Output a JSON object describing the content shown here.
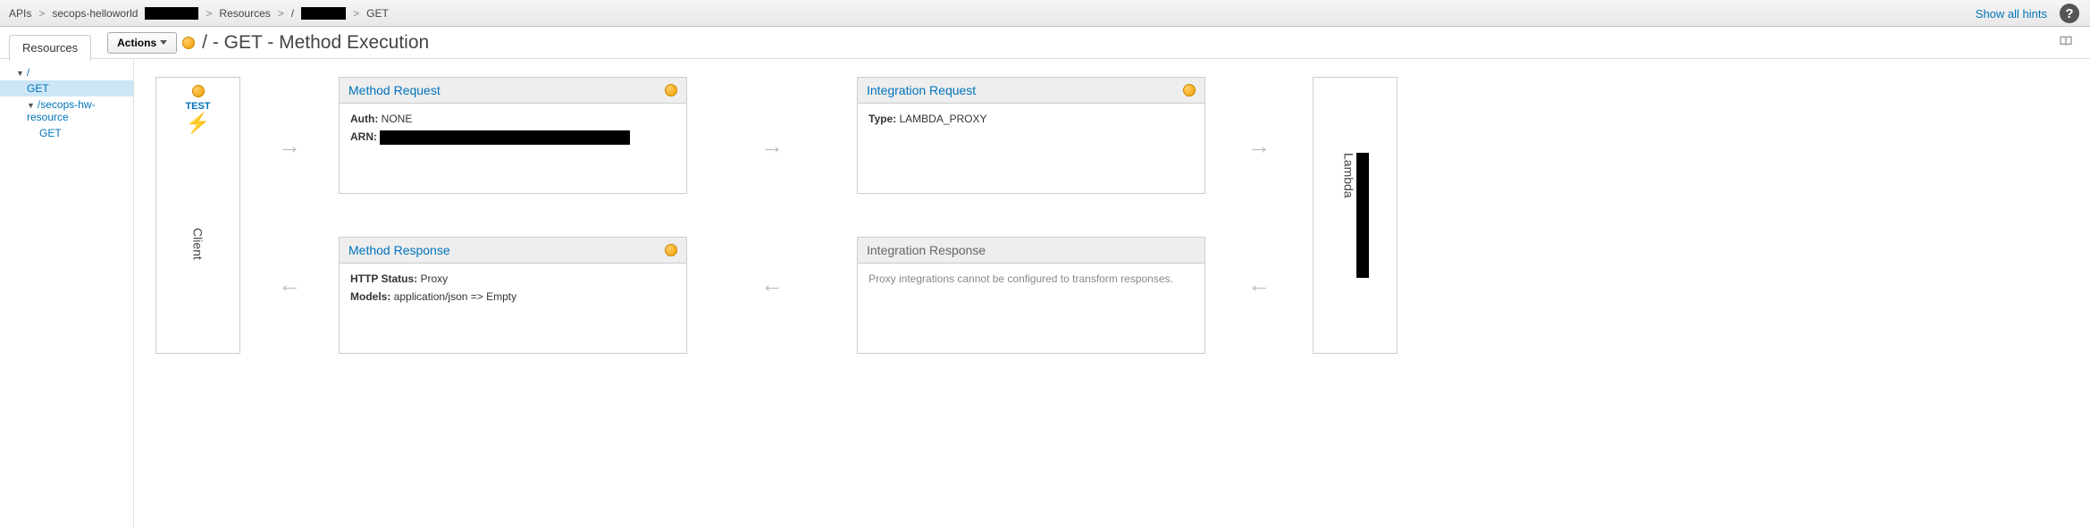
{
  "breadcrumb": {
    "apis": "APIs",
    "api_name": "secops-helloworld",
    "resources": "Resources",
    "path": "/",
    "method": "GET"
  },
  "topbar": {
    "show_hints": "Show all hints"
  },
  "toolbar": {
    "resources_tab": "Resources",
    "actions_label": "Actions",
    "page_title": "/ - GET - Method Execution"
  },
  "tree": {
    "root": "/",
    "root_get": "GET",
    "child_resource": "/secops-hw-resource",
    "child_get": "GET"
  },
  "client": {
    "label": "Client",
    "test": "TEST"
  },
  "lambda": {
    "label": "Lambda"
  },
  "cards": {
    "method_request": {
      "title": "Method Request",
      "auth_label": "Auth:",
      "auth_value": "NONE",
      "arn_label": "ARN:"
    },
    "method_response": {
      "title": "Method Response",
      "http_status_label": "HTTP Status:",
      "http_status_value": "Proxy",
      "models_label": "Models:",
      "models_value": "application/json => Empty"
    },
    "integration_request": {
      "title": "Integration Request",
      "type_label": "Type:",
      "type_value": "LAMBDA_PROXY"
    },
    "integration_response": {
      "title": "Integration Response",
      "message": "Proxy integrations cannot be configured to transform responses."
    }
  }
}
